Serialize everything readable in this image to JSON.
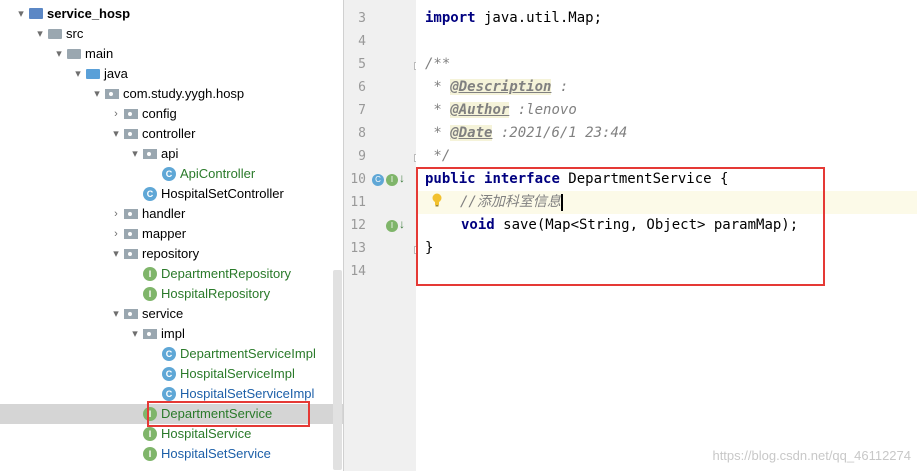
{
  "project_tree": {
    "items": [
      {
        "label": "service_hosp",
        "depth": 1,
        "arrow": "▾",
        "icon": "module-folder-icon",
        "bold": true
      },
      {
        "label": "src",
        "depth": 2,
        "arrow": "▾",
        "icon": "folder-icon"
      },
      {
        "label": "main",
        "depth": 3,
        "arrow": "▾",
        "icon": "folder-icon"
      },
      {
        "label": "java",
        "depth": 4,
        "arrow": "▾",
        "icon": "source-folder-icon"
      },
      {
        "label": "com.study.yygh.hosp",
        "depth": 5,
        "arrow": "▾",
        "icon": "package-icon"
      },
      {
        "label": "config",
        "depth": 6,
        "arrow": "›",
        "icon": "package-icon"
      },
      {
        "label": "controller",
        "depth": 6,
        "arrow": "▾",
        "icon": "package-icon"
      },
      {
        "label": "api",
        "depth": 7,
        "arrow": "▾",
        "icon": "package-icon"
      },
      {
        "label": "ApiController",
        "depth": 8,
        "arrow": "",
        "icon": "class-icon",
        "green": true
      },
      {
        "label": "HospitalSetController",
        "depth": 7,
        "arrow": "",
        "icon": "class-icon"
      },
      {
        "label": "handler",
        "depth": 6,
        "arrow": "›",
        "icon": "package-icon"
      },
      {
        "label": "mapper",
        "depth": 6,
        "arrow": "›",
        "icon": "package-icon"
      },
      {
        "label": "repository",
        "depth": 6,
        "arrow": "▾",
        "icon": "package-icon"
      },
      {
        "label": "DepartmentRepository",
        "depth": 7,
        "arrow": "",
        "icon": "interface-icon",
        "green": true
      },
      {
        "label": "HospitalRepository",
        "depth": 7,
        "arrow": "",
        "icon": "interface-icon",
        "green": true
      },
      {
        "label": "service",
        "depth": 6,
        "arrow": "▾",
        "icon": "package-icon"
      },
      {
        "label": "impl",
        "depth": 7,
        "arrow": "▾",
        "icon": "package-icon"
      },
      {
        "label": "DepartmentServiceImpl",
        "depth": 8,
        "arrow": "",
        "icon": "class-icon",
        "green": true
      },
      {
        "label": "HospitalServiceImpl",
        "depth": 8,
        "arrow": "",
        "icon": "class-icon",
        "green": true
      },
      {
        "label": "HospitalSetServiceImpl",
        "depth": 8,
        "arrow": "",
        "icon": "class-icon",
        "blue": true
      },
      {
        "label": "DepartmentService",
        "depth": 7,
        "arrow": "",
        "icon": "interface-icon",
        "green": true,
        "selected": true
      },
      {
        "label": "HospitalService",
        "depth": 7,
        "arrow": "",
        "icon": "interface-icon",
        "green": true
      },
      {
        "label": "HospitalSetService",
        "depth": 7,
        "arrow": "",
        "icon": "interface-icon",
        "blue": true
      }
    ],
    "icon_text": {
      "class": "C",
      "interface": "I"
    }
  },
  "editor": {
    "line_numbers": [
      "3",
      "4",
      "5",
      "6",
      "7",
      "8",
      "9",
      "10",
      "11",
      "12",
      "13",
      "14"
    ],
    "lines": {
      "l3_kw": "import",
      "l3_rest": " java.util.Map;",
      "l5": "/**",
      "l6_star": " * ",
      "l6_tag": "@Description",
      "l6_val": " :",
      "l7_star": " * ",
      "l7_tag": "@Author",
      "l7_val": " :lenovo",
      "l8_star": " * ",
      "l8_tag": "@Date",
      "l8_val": " :2021/6/1 23:44",
      "l9": " */",
      "l10_kw1": "public",
      "l10_kw2": "interface",
      "l10_rest": " DepartmentService {",
      "l11_cmt": "//添加科室信息",
      "l12_kw": "void",
      "l12_rest": " save(Map<String, Object> paramMap);",
      "l13": "}"
    },
    "gutter_marks": [
      "C",
      "I",
      "I"
    ]
  },
  "watermark": "https://blog.csdn.net/qq_46112274",
  "colors": {
    "highlight_box": "#e53935",
    "keyword": "#000080",
    "comment": "#808080"
  }
}
